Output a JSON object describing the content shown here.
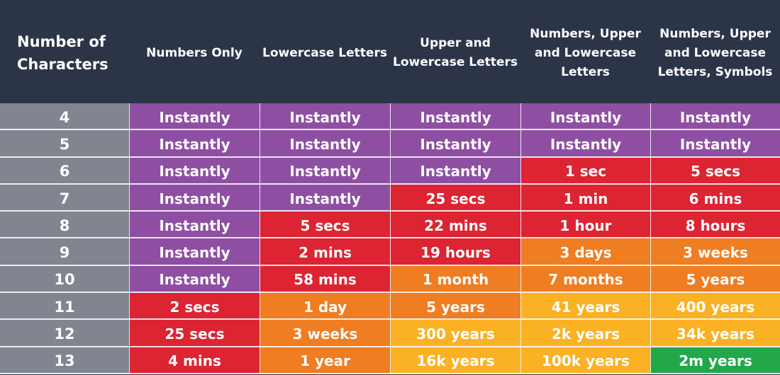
{
  "colors": {
    "header": "#2c3548",
    "characters": "#80858f",
    "P": "#8e4fa3",
    "R": "#dc2433",
    "O": "#ef7d22",
    "Y": "#fbb124",
    "G": "#22a84a"
  },
  "headers": [
    "Number of Characters",
    "Numbers Only",
    "Lowercase Letters",
    "Upper and Lowercase Letters",
    "Numbers, Upper and Lowercase Letters",
    "Numbers, Upper and Lowercase Letters, Symbols"
  ],
  "rows": [
    {
      "chars": "4",
      "values": [
        "Instantly",
        "Instantly",
        "Instantly",
        "Instantly",
        "Instantly"
      ],
      "levels": "PPPPP"
    },
    {
      "chars": "5",
      "values": [
        "Instantly",
        "Instantly",
        "Instantly",
        "Instantly",
        "Instantly"
      ],
      "levels": "PPPPP"
    },
    {
      "chars": "6",
      "values": [
        "Instantly",
        "Instantly",
        "Instantly",
        "1 sec",
        "5 secs"
      ],
      "levels": "PPPRR"
    },
    {
      "chars": "7",
      "values": [
        "Instantly",
        "Instantly",
        "25 secs",
        "1 min",
        "6 mins"
      ],
      "levels": "PPRRR"
    },
    {
      "chars": "8",
      "values": [
        "Instantly",
        "5 secs",
        "22 mins",
        "1 hour",
        "8 hours"
      ],
      "levels": "PRRRR"
    },
    {
      "chars": "9",
      "values": [
        "Instantly",
        "2 mins",
        "19 hours",
        "3 days",
        "3 weeks"
      ],
      "levels": "PRROO"
    },
    {
      "chars": "10",
      "values": [
        "Instantly",
        "58 mins",
        "1 month",
        "7 months",
        "5 years"
      ],
      "levels": "PROOO"
    },
    {
      "chars": "11",
      "values": [
        "2 secs",
        "1 day",
        "5 years",
        "41 years",
        "400 years"
      ],
      "levels": "ROOYY"
    },
    {
      "chars": "12",
      "values": [
        "25 secs",
        "3 weeks",
        "300 years",
        "2k years",
        "34k years"
      ],
      "levels": "ROYYY"
    },
    {
      "chars": "13",
      "values": [
        "4 mins",
        "1 year",
        "16k years",
        "100k years",
        "2m years"
      ],
      "levels": "ROYYG"
    }
  ]
}
